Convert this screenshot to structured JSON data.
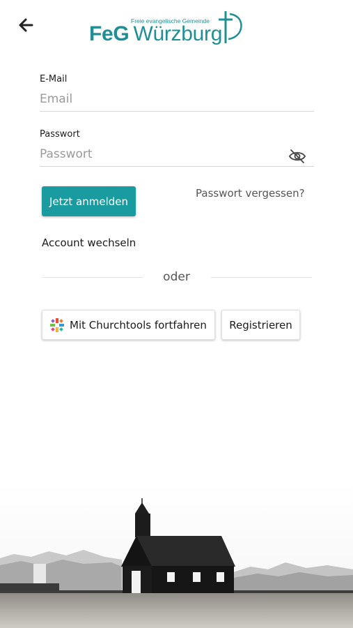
{
  "header": {
    "back_icon": "arrow-left-icon",
    "logo_tagline": "Freie evangelische Gemeinde",
    "logo_feg": "FeG",
    "logo_city": "Würzburg"
  },
  "login": {
    "email_label": "E-Mail",
    "email_placeholder": "Email",
    "email_value": "",
    "password_label": "Passwort",
    "password_placeholder": "Passwort",
    "password_value": "",
    "password_toggle_icon": "eye-off-icon",
    "submit_label": "Jetzt anmelden",
    "forgot_label": "Passwort vergessen?",
    "switch_account_label": "Account wechseln"
  },
  "divider": {
    "label": "oder"
  },
  "alternatives": {
    "churchtools_label": "Mit Churchtools fortfahren",
    "churchtools_icon": "churchtools-logo-icon",
    "register_label": "Registrieren"
  },
  "colors": {
    "brand": "#1f8f94",
    "primary_button": "#1a9ba0"
  }
}
